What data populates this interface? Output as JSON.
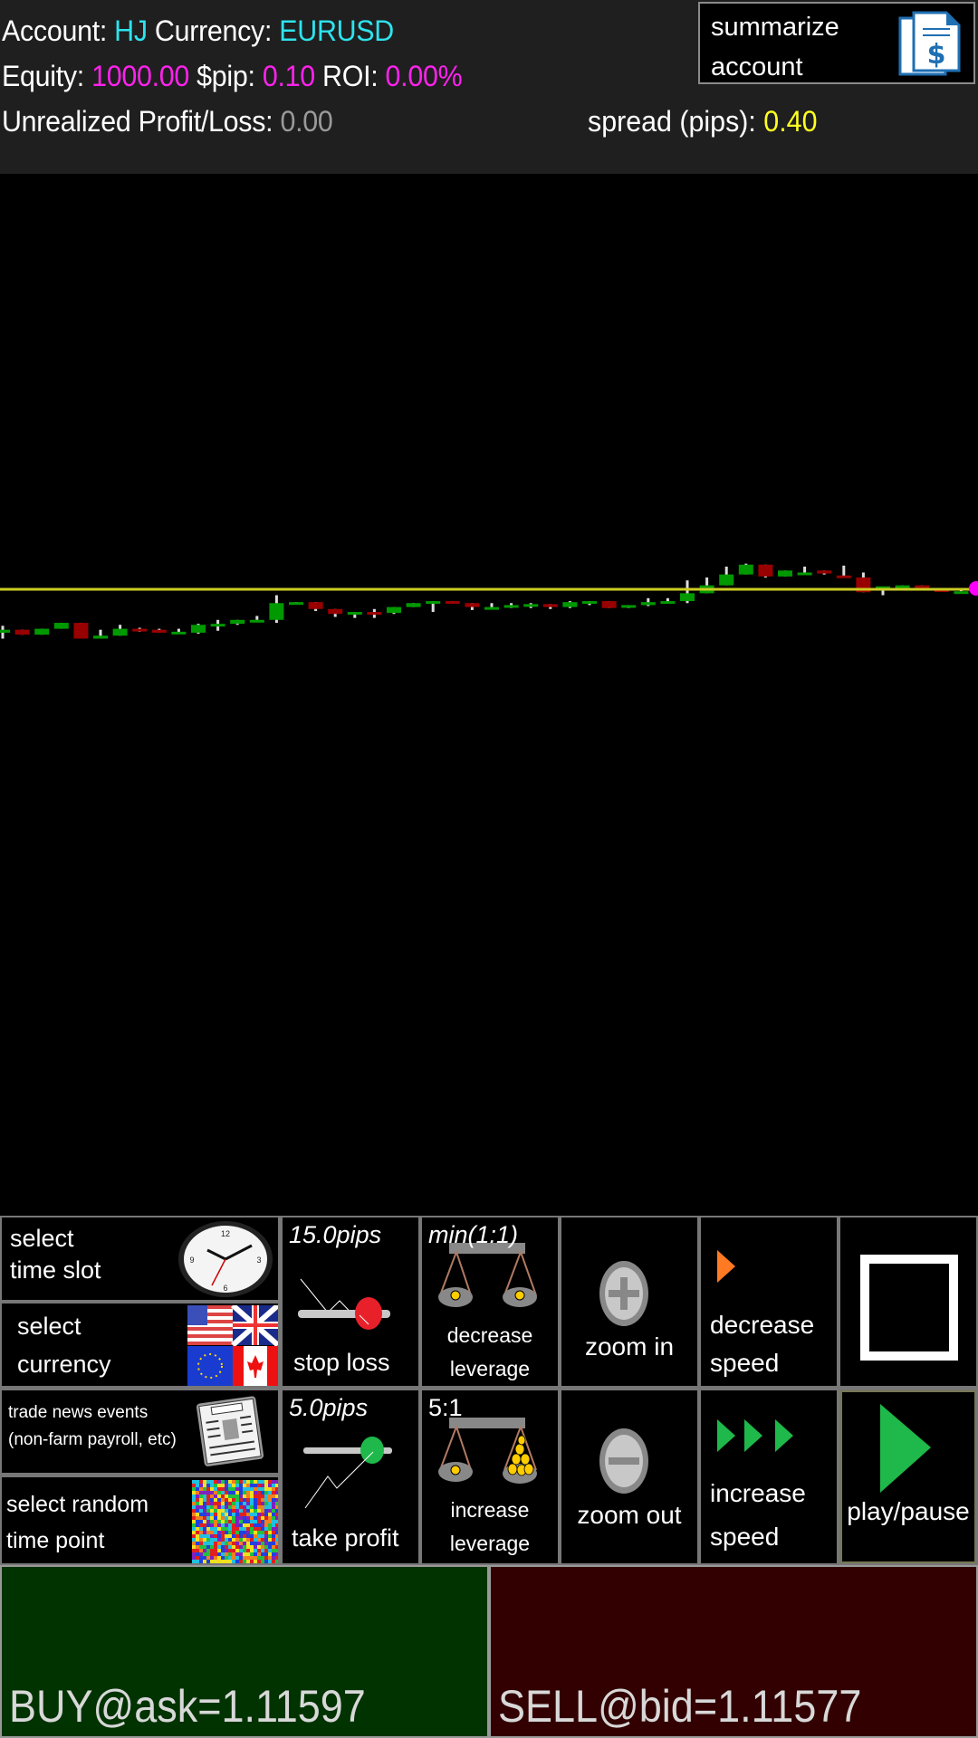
{
  "header": {
    "account_label": "Account: ",
    "account_value": "HJ",
    "currency_label": " Currency: ",
    "currency_value": "EURUSD",
    "equity_label": "Equity: ",
    "equity_value": "1000.00",
    "pip_label": " $pip: ",
    "pip_value": "0.10",
    "roi_label": " ROI: ",
    "roi_value": "0.00%",
    "pl_label": "Unrealized Profit/Loss: ",
    "pl_value": "0.00",
    "spread_label": "spread (pips): ",
    "spread_value": "0.40",
    "summarize_line1": "summarize",
    "summarize_line2": "account"
  },
  "controls": {
    "time_slot": {
      "line1": "select",
      "line2": "time slot"
    },
    "currency": {
      "line1": "select",
      "line2": "currency"
    },
    "news": {
      "line1": "trade news events",
      "line2": "(non-farm payroll, etc)"
    },
    "random": {
      "line1": "select random",
      "line2": "time point"
    },
    "stop_loss": {
      "value": "15.0pips",
      "label": "stop loss"
    },
    "take_profit": {
      "value": "5.0pips",
      "label": "take profit"
    },
    "decrease_leverage": {
      "value": "min(1:1)",
      "line1": "decrease",
      "line2": "leverage"
    },
    "increase_leverage": {
      "value": "5:1",
      "line1": "increase",
      "line2": "leverage"
    },
    "zoom_in": "zoom in",
    "zoom_out": "zoom out",
    "decrease_speed": {
      "line1": "decrease",
      "line2": "speed"
    },
    "increase_speed": {
      "line1": "increase",
      "line2": "speed"
    },
    "play_pause": "play/pause"
  },
  "trade": {
    "buy_label": "BUY@ask=1.11597",
    "sell_label": "SELL@bid=1.11577"
  },
  "colors": {
    "bull": "#009900",
    "bear": "#990000",
    "wick": "#dddddd",
    "price_line": "#cccc22",
    "price_marker": "#ff00ff"
  },
  "chart_data": {
    "type": "candlestick",
    "symbol": "EURUSD",
    "current_bid": 1.11577,
    "candles": [
      {
        "o": 1.11533,
        "h": 1.1154,
        "l": 1.11527,
        "c": 1.11536
      },
      {
        "o": 1.11536,
        "h": 1.11536,
        "l": 1.11531,
        "c": 1.11531
      },
      {
        "o": 1.11531,
        "h": 1.11537,
        "l": 1.11531,
        "c": 1.11537
      },
      {
        "o": 1.11537,
        "h": 1.11543,
        "l": 1.11537,
        "c": 1.11543
      },
      {
        "o": 1.11543,
        "h": 1.11543,
        "l": 1.11527,
        "c": 1.11527
      },
      {
        "o": 1.11527,
        "h": 1.11536,
        "l": 1.11527,
        "c": 1.1153
      },
      {
        "o": 1.1153,
        "h": 1.11541,
        "l": 1.1153,
        "c": 1.11537
      },
      {
        "o": 1.11537,
        "h": 1.11538,
        "l": 1.11534,
        "c": 1.11536
      },
      {
        "o": 1.11536,
        "h": 1.11537,
        "l": 1.11533,
        "c": 1.11533
      },
      {
        "o": 1.11533,
        "h": 1.11537,
        "l": 1.11533,
        "c": 1.11534
      },
      {
        "o": 1.11533,
        "h": 1.11542,
        "l": 1.11532,
        "c": 1.11541
      },
      {
        "o": 1.11541,
        "h": 1.11546,
        "l": 1.11535,
        "c": 1.11542
      },
      {
        "o": 1.11542,
        "h": 1.11546,
        "l": 1.11541,
        "c": 1.11546
      },
      {
        "o": 1.11546,
        "h": 1.1155,
        "l": 1.11546,
        "c": 1.11546
      },
      {
        "o": 1.11546,
        "h": 1.11571,
        "l": 1.11543,
        "c": 1.11563
      },
      {
        "o": 1.11563,
        "h": 1.11564,
        "l": 1.11563,
        "c": 1.11564
      },
      {
        "o": 1.11564,
        "h": 1.11564,
        "l": 1.11555,
        "c": 1.11557
      },
      {
        "o": 1.11557,
        "h": 1.11557,
        "l": 1.11549,
        "c": 1.11552
      },
      {
        "o": 1.11552,
        "h": 1.11554,
        "l": 1.11548,
        "c": 1.11554
      },
      {
        "o": 1.11554,
        "h": 1.11557,
        "l": 1.11548,
        "c": 1.11552
      },
      {
        "o": 1.11553,
        "h": 1.11559,
        "l": 1.11552,
        "c": 1.11559
      },
      {
        "o": 1.11559,
        "h": 1.11563,
        "l": 1.11559,
        "c": 1.11563
      },
      {
        "o": 1.11563,
        "h": 1.11565,
        "l": 1.11554,
        "c": 1.11565
      },
      {
        "o": 1.11565,
        "h": 1.11565,
        "l": 1.11563,
        "c": 1.11564
      },
      {
        "o": 1.11563,
        "h": 1.11563,
        "l": 1.11556,
        "c": 1.11559
      },
      {
        "o": 1.11558,
        "h": 1.11563,
        "l": 1.11558,
        "c": 1.11559
      },
      {
        "o": 1.11559,
        "h": 1.11563,
        "l": 1.11558,
        "c": 1.11561
      },
      {
        "o": 1.11561,
        "h": 1.11563,
        "l": 1.11558,
        "c": 1.11562
      },
      {
        "o": 1.11562,
        "h": 1.11562,
        "l": 1.11557,
        "c": 1.11559
      },
      {
        "o": 1.11559,
        "h": 1.11565,
        "l": 1.11558,
        "c": 1.11564
      },
      {
        "o": 1.11564,
        "h": 1.11565,
        "l": 1.11561,
        "c": 1.11565
      },
      {
        "o": 1.11565,
        "h": 1.11565,
        "l": 1.11558,
        "c": 1.11558
      },
      {
        "o": 1.1156,
        "h": 1.11561,
        "l": 1.11558,
        "c": 1.11561
      },
      {
        "o": 1.11561,
        "h": 1.11568,
        "l": 1.1156,
        "c": 1.11564
      },
      {
        "o": 1.11564,
        "h": 1.11568,
        "l": 1.11564,
        "c": 1.11565
      },
      {
        "o": 1.11565,
        "h": 1.11586,
        "l": 1.11563,
        "c": 1.11573
      },
      {
        "o": 1.11573,
        "h": 1.11589,
        "l": 1.11573,
        "c": 1.11581
      },
      {
        "o": 1.11581,
        "h": 1.116,
        "l": 1.11581,
        "c": 1.11592
      },
      {
        "o": 1.11592,
        "h": 1.11603,
        "l": 1.11592,
        "c": 1.11602
      },
      {
        "o": 1.11602,
        "h": 1.11602,
        "l": 1.11589,
        "c": 1.1159
      },
      {
        "o": 1.1159,
        "h": 1.11596,
        "l": 1.1159,
        "c": 1.11596
      },
      {
        "o": 1.11594,
        "h": 1.116,
        "l": 1.11594,
        "c": 1.11594
      },
      {
        "o": 1.11596,
        "h": 1.11596,
        "l": 1.11592,
        "c": 1.11593
      },
      {
        "o": 1.11591,
        "h": 1.11601,
        "l": 1.11589,
        "c": 1.11589
      },
      {
        "o": 1.11589,
        "h": 1.11594,
        "l": 1.11574,
        "c": 1.11574
      },
      {
        "o": 1.11577,
        "h": 1.11577,
        "l": 1.11571,
        "c": 1.1158
      },
      {
        "o": 1.1158,
        "h": 1.11581,
        "l": 1.1158,
        "c": 1.11581
      },
      {
        "o": 1.11581,
        "h": 1.11581,
        "l": 1.11576,
        "c": 1.11577
      },
      {
        "o": 1.11577,
        "h": 1.11577,
        "l": 1.11575,
        "c": 1.11575
      },
      {
        "o": 1.11575,
        "h": 1.11576,
        "l": 1.11575,
        "c": 1.11575
      }
    ]
  }
}
